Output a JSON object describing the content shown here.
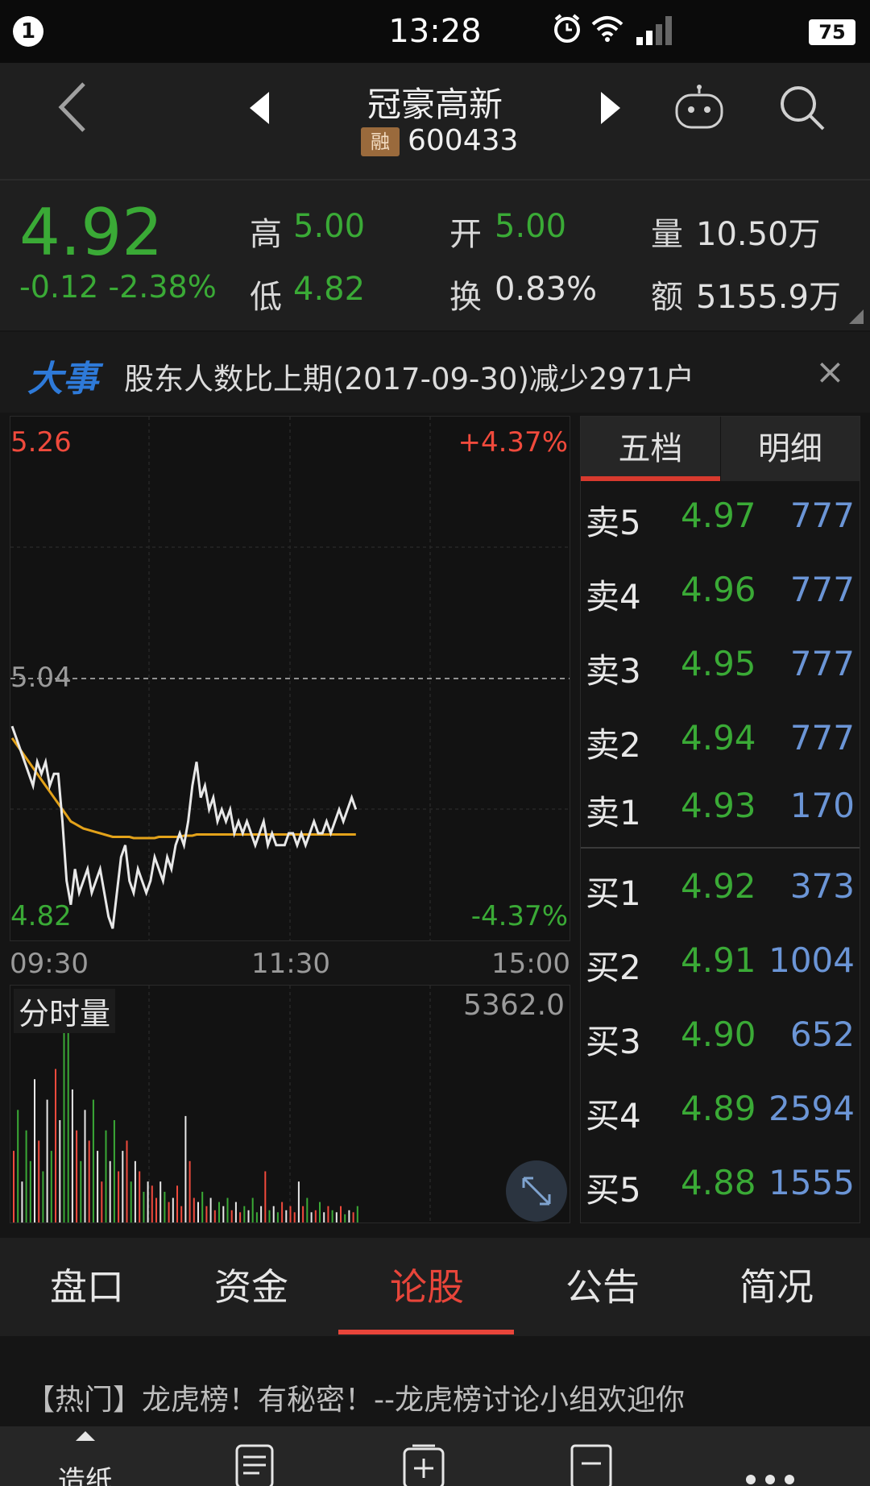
{
  "status_bar": {
    "notif_count": "1",
    "time": "13:28",
    "battery": "75"
  },
  "header": {
    "stock_name": "冠豪高新",
    "margin_badge": "融",
    "stock_code": "600433"
  },
  "quote": {
    "price": "4.92",
    "change": "-0.12 -2.38%",
    "high_label": "高",
    "high": "5.00",
    "open_label": "开",
    "open": "5.00",
    "volume_label": "量",
    "volume": "10.50万",
    "low_label": "低",
    "low": "4.82",
    "turnover_label": "换",
    "turnover": "0.83%",
    "amount_label": "额",
    "amount": "5155.9万"
  },
  "news": {
    "tag": "大事",
    "text": "股东人数比上期(2017-09-30)减少2971户",
    "close": "×"
  },
  "chart": {
    "y_top": "5.26",
    "y_top_pct": "+4.37%",
    "y_mid": "5.04",
    "y_bottom": "4.82",
    "y_bottom_pct": "-4.37%",
    "time_labels": [
      "09:30",
      "11:30",
      "15:00"
    ],
    "volume_label": "分时量",
    "volume_max": "5362.0"
  },
  "chart_data": {
    "type": "line",
    "ylim": [
      4.82,
      5.26
    ],
    "prev_close": 5.04,
    "series": [
      {
        "values": [
          5.0,
          4.99,
          4.98,
          4.97,
          4.96,
          4.95,
          4.97,
          4.96,
          4.97,
          4.95,
          4.96,
          4.96,
          4.92,
          4.87,
          4.85,
          4.88,
          4.86,
          4.87,
          4.88,
          4.86,
          4.87,
          4.88,
          4.86,
          4.84,
          4.83,
          4.86,
          4.89,
          4.9,
          4.87,
          4.86,
          4.88,
          4.87,
          4.86,
          4.87,
          4.89,
          4.88,
          4.87,
          4.89,
          4.88,
          4.9,
          4.91,
          4.9,
          4.92,
          4.95,
          4.97,
          4.94,
          4.95,
          4.93,
          4.94,
          4.92,
          4.93,
          4.92,
          4.93,
          4.91,
          4.92,
          4.91,
          4.92,
          4.91,
          4.9,
          4.91,
          4.92,
          4.9,
          4.91,
          4.9,
          4.9,
          4.9,
          4.91,
          4.91,
          4.9,
          4.91,
          4.9,
          4.91,
          4.92,
          4.91,
          4.91,
          4.92,
          4.91,
          4.92,
          4.93,
          4.92,
          4.93,
          4.94,
          4.93
        ]
      },
      {
        "values": [
          4.99,
          4.985,
          4.98,
          4.975,
          4.97,
          4.965,
          4.96,
          4.955,
          4.95,
          4.945,
          4.94,
          4.935,
          4.93,
          4.925,
          4.92,
          4.918,
          4.916,
          4.914,
          4.913,
          4.912,
          4.911,
          4.91,
          4.909,
          4.908,
          4.907,
          4.907,
          4.907,
          4.907,
          4.907,
          4.906,
          4.906,
          4.906,
          4.906,
          4.906,
          4.906,
          4.907,
          4.907,
          4.907,
          4.907,
          4.907,
          4.907,
          4.908,
          4.908,
          4.908,
          4.909,
          4.909,
          4.909,
          4.909,
          4.909,
          4.909,
          4.909,
          4.909,
          4.909,
          4.909,
          4.909,
          4.909,
          4.909,
          4.909,
          4.909,
          4.909,
          4.909,
          4.909,
          4.909,
          4.909,
          4.909,
          4.909,
          4.909,
          4.909,
          4.909,
          4.909,
          4.909,
          4.909,
          4.909,
          4.909,
          4.909,
          4.909,
          4.909,
          4.909,
          4.909,
          4.909,
          4.909,
          4.909,
          4.909
        ]
      }
    ],
    "volumes": [
      0.35,
      0.55,
      0.2,
      0.45,
      0.3,
      0.7,
      0.4,
      0.25,
      0.6,
      0.35,
      0.75,
      0.5,
      0.95,
      1.0,
      0.65,
      0.45,
      0.3,
      0.55,
      0.4,
      0.6,
      0.35,
      0.2,
      0.45,
      0.3,
      0.5,
      0.25,
      0.35,
      0.4,
      0.2,
      0.3,
      0.25,
      0.15,
      0.2,
      0.18,
      0.12,
      0.2,
      0.15,
      0.1,
      0.12,
      0.18,
      0.08,
      0.52,
      0.3,
      0.12,
      0.1,
      0.15,
      0.08,
      0.12,
      0.06,
      0.1,
      0.08,
      0.12,
      0.06,
      0.1,
      0.05,
      0.08,
      0.06,
      0.12,
      0.05,
      0.08,
      0.25,
      0.06,
      0.08,
      0.05,
      0.1,
      0.06,
      0.08,
      0.05,
      0.2,
      0.08,
      0.12,
      0.05,
      0.06,
      0.1,
      0.05,
      0.08,
      0.06,
      0.05,
      0.08,
      0.04,
      0.06,
      0.05,
      0.08
    ],
    "colors": {
      "price": "#e8e8e8",
      "avg": "#e3a21a",
      "up": "#f04a3c",
      "down": "#3aaa36"
    }
  },
  "orderbook": {
    "tabs": [
      "五档",
      "明细"
    ],
    "rows": [
      {
        "label": "卖5",
        "price": "4.97",
        "vol": "777"
      },
      {
        "label": "卖4",
        "price": "4.96",
        "vol": "777"
      },
      {
        "label": "卖3",
        "price": "4.95",
        "vol": "777"
      },
      {
        "label": "卖2",
        "price": "4.94",
        "vol": "777"
      },
      {
        "label": "卖1",
        "price": "4.93",
        "vol": "170"
      },
      {
        "label": "买1",
        "price": "4.92",
        "vol": "373"
      },
      {
        "label": "买2",
        "price": "4.91",
        "vol": "1004"
      },
      {
        "label": "买3",
        "price": "4.90",
        "vol": "652"
      },
      {
        "label": "买4",
        "price": "4.89",
        "vol": "2594"
      },
      {
        "label": "买5",
        "price": "4.88",
        "vol": "1555"
      }
    ]
  },
  "main_tabs": [
    "盘口",
    "资金",
    "论股",
    "公告",
    "简况"
  ],
  "active_tab": "论股",
  "post": {
    "text": "【热门】龙虎榜！有秘密！--龙虎榜讨论小组欢迎你"
  },
  "bottom_bar": {
    "items": [
      "造纸",
      "",
      "",
      "",
      ""
    ]
  }
}
